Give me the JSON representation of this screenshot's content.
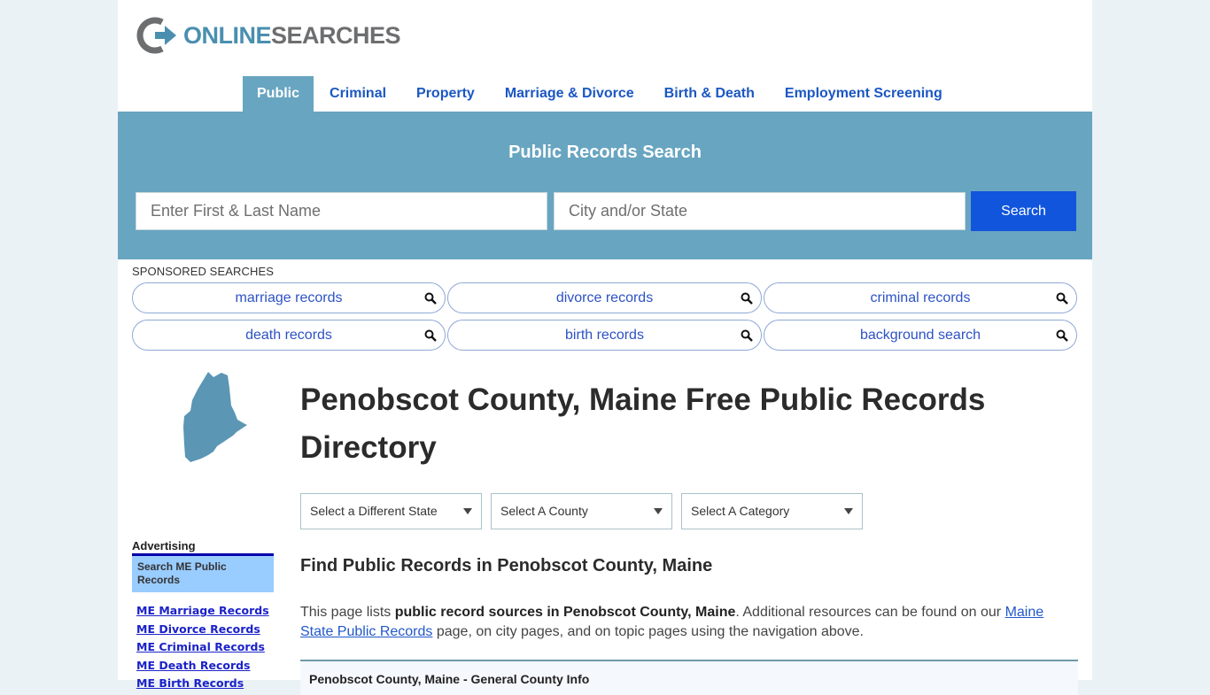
{
  "brand": {
    "logo_word1": "ONLINE",
    "logo_word2": "SEARCHES",
    "icon": "logo-circle-arrow-icon",
    "colors": {
      "blue": "#4a8fb0",
      "gray": "#6d6e70"
    }
  },
  "nav": {
    "items": [
      {
        "label": "Public",
        "active": true
      },
      {
        "label": "Criminal"
      },
      {
        "label": "Property"
      },
      {
        "label": "Marriage & Divorce"
      },
      {
        "label": "Birth & Death"
      },
      {
        "label": "Employment Screening"
      }
    ]
  },
  "hero": {
    "title": "Public Records Search",
    "name_placeholder": "Enter First & Last Name",
    "name_value": "",
    "city_placeholder": "City and/or State",
    "city_value": "",
    "search_label": "Search",
    "colors": {
      "band": "#68a5c1",
      "button": "#1155dc"
    }
  },
  "sponsored": {
    "label": "SPONSORED SEARCHES",
    "items": [
      {
        "label": "marriage records",
        "icon": "search-icon"
      },
      {
        "label": "divorce records",
        "icon": "search-icon"
      },
      {
        "label": "criminal records",
        "icon": "search-icon"
      },
      {
        "label": "death records",
        "icon": "search-icon"
      },
      {
        "label": "birth records",
        "icon": "search-icon"
      },
      {
        "label": "background search",
        "icon": "search-icon"
      }
    ]
  },
  "sidebar": {
    "map_icon": "maine-state-map-icon",
    "advertising_title": "Advertising",
    "ad_box_text": "Search ME Public Records",
    "links": [
      "ME Marriage Records",
      "ME Divorce Records",
      "ME Criminal Records",
      "ME Death Records",
      "ME Birth Records"
    ]
  },
  "main": {
    "title": "Penobscot County, Maine Free Public Records Directory",
    "selects": [
      {
        "value": "Select a Different State"
      },
      {
        "value": "Select A County"
      },
      {
        "value": "Select A Category"
      }
    ],
    "section_title": "Find Public Records in Penobscot County, Maine",
    "intro": {
      "before": "This page lists ",
      "bold": "public record sources in Penobscot County, Maine",
      "middle": ". Additional resources can be found on our ",
      "link": "Maine State Public Records",
      "after": " page, on city pages, and on topic pages using the navigation above."
    },
    "info_box_title": "Penobscot County, Maine - General County Info"
  }
}
